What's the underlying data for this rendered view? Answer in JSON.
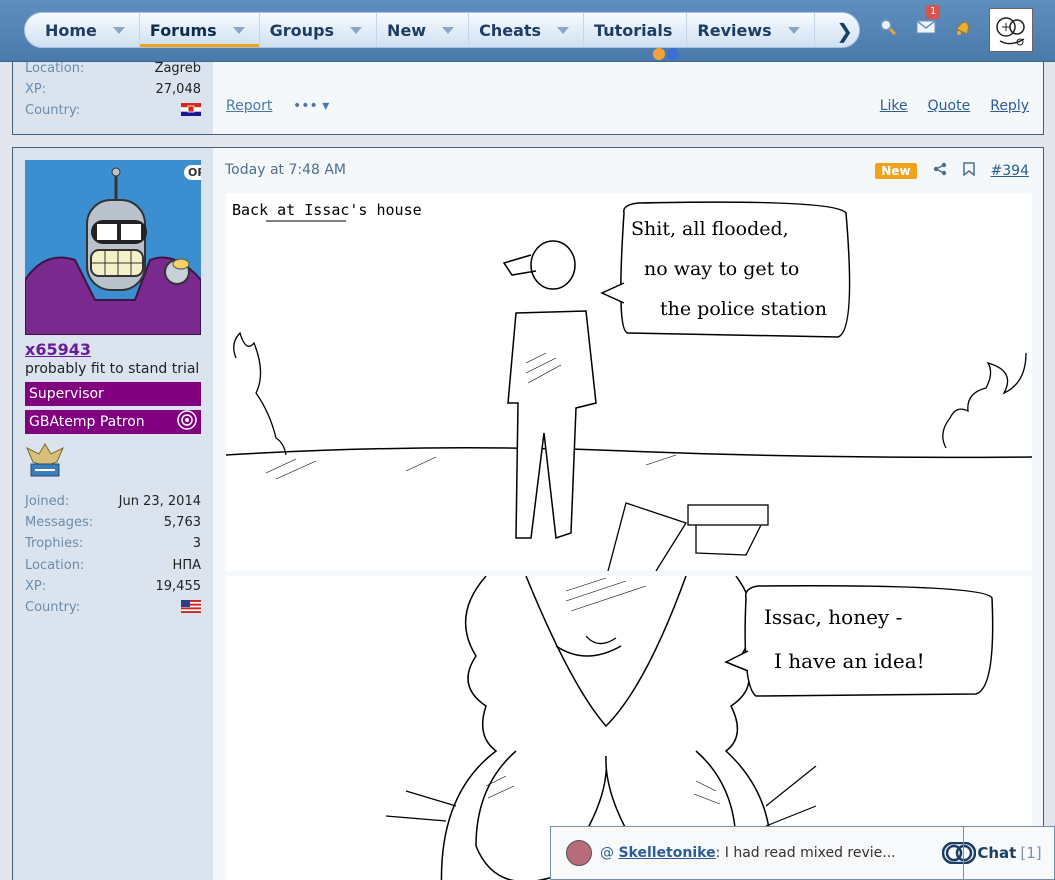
{
  "nav": {
    "tabs": [
      {
        "label": "Home"
      },
      {
        "label": "Forums"
      },
      {
        "label": "Groups"
      },
      {
        "label": "New"
      },
      {
        "label": "Cheats"
      },
      {
        "label": "Tutorials"
      },
      {
        "label": "Reviews"
      }
    ],
    "active_tab": "Forums",
    "inbox_badge": "1"
  },
  "prev_post": {
    "details": [
      {
        "key": "Location:",
        "value": "Zagreb"
      },
      {
        "key": "XP:",
        "value": "27,048"
      },
      {
        "key": "Country:",
        "value": ""
      }
    ],
    "report_label": "Report",
    "more_label": "•••",
    "actions": {
      "like": "Like",
      "quote": "Quote",
      "reply": "Reply"
    }
  },
  "post": {
    "op_badge": "OP",
    "username": "x65943",
    "user_title": "probably fit to stand trial",
    "banners": [
      "Supervisor",
      "GBAtemp Patron"
    ],
    "details": [
      {
        "key": "Joined:",
        "value": "Jun 23, 2014"
      },
      {
        "key": "Messages:",
        "value": "5,763"
      },
      {
        "key": "Trophies:",
        "value": "3"
      },
      {
        "key": "Location:",
        "value": "НПА"
      },
      {
        "key": "XP:",
        "value": "19,455"
      },
      {
        "key": "Country:",
        "value": ""
      }
    ],
    "timestamp": "Today at 7:48 AM",
    "new_label": "New",
    "post_number": "#394",
    "comic": {
      "caption": "Back at Issac's house",
      "bubble1": [
        "Shit, all flooded,",
        "no way to get to",
        "the police station"
      ],
      "bubble2": [
        "Issac, honey -",
        "I have an idea!"
      ]
    }
  },
  "chat": {
    "at": "@",
    "user": "Skelletonike",
    "message": ": I had read mixed revie...",
    "button_label": "Chat",
    "count": "[1]"
  }
}
